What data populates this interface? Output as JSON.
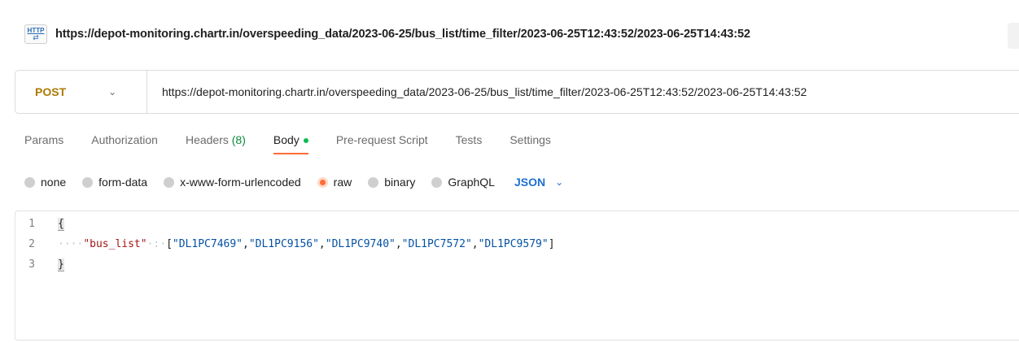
{
  "request": {
    "icon_label": "HTTP",
    "title": "https://depot-monitoring.chartr.in/overspeeding_data/2023-06-25/bus_list/time_filter/2023-06-25T12:43:52/2023-06-25T14:43:52"
  },
  "url_bar": {
    "method": "POST",
    "url": "https://depot-monitoring.chartr.in/overspeeding_data/2023-06-25/bus_list/time_filter/2023-06-25T12:43:52/2023-06-25T14:43:52"
  },
  "tabs": {
    "params": "Params",
    "authorization": "Authorization",
    "headers": "Headers",
    "headers_count": "(8)",
    "body": "Body",
    "prerequest": "Pre-request Script",
    "tests": "Tests",
    "settings": "Settings"
  },
  "body_types": {
    "none": "none",
    "form_data": "form-data",
    "urlencoded": "x-www-form-urlencoded",
    "raw": "raw",
    "binary": "binary",
    "graphql": "GraphQL",
    "format": "JSON"
  },
  "editor": {
    "line_numbers": [
      "1",
      "2",
      "3"
    ],
    "open_brace": "{",
    "close_brace": "}",
    "indent": "····",
    "key": "\"bus_list\"",
    "sep": "·:·",
    "bracket_open": "[",
    "bracket_close": "]",
    "comma": ",",
    "values": [
      "\"DL1PC7469\"",
      "\"DL1PC9156\"",
      "\"DL1PC9740\"",
      "\"DL1PC7572\"",
      "\"DL1PC9579\""
    ]
  },
  "colors": {
    "accent": "#ff6c37",
    "method": "#ad7a03",
    "json_select": "#1f6fd1",
    "headers_count": "#0b8a3b"
  }
}
